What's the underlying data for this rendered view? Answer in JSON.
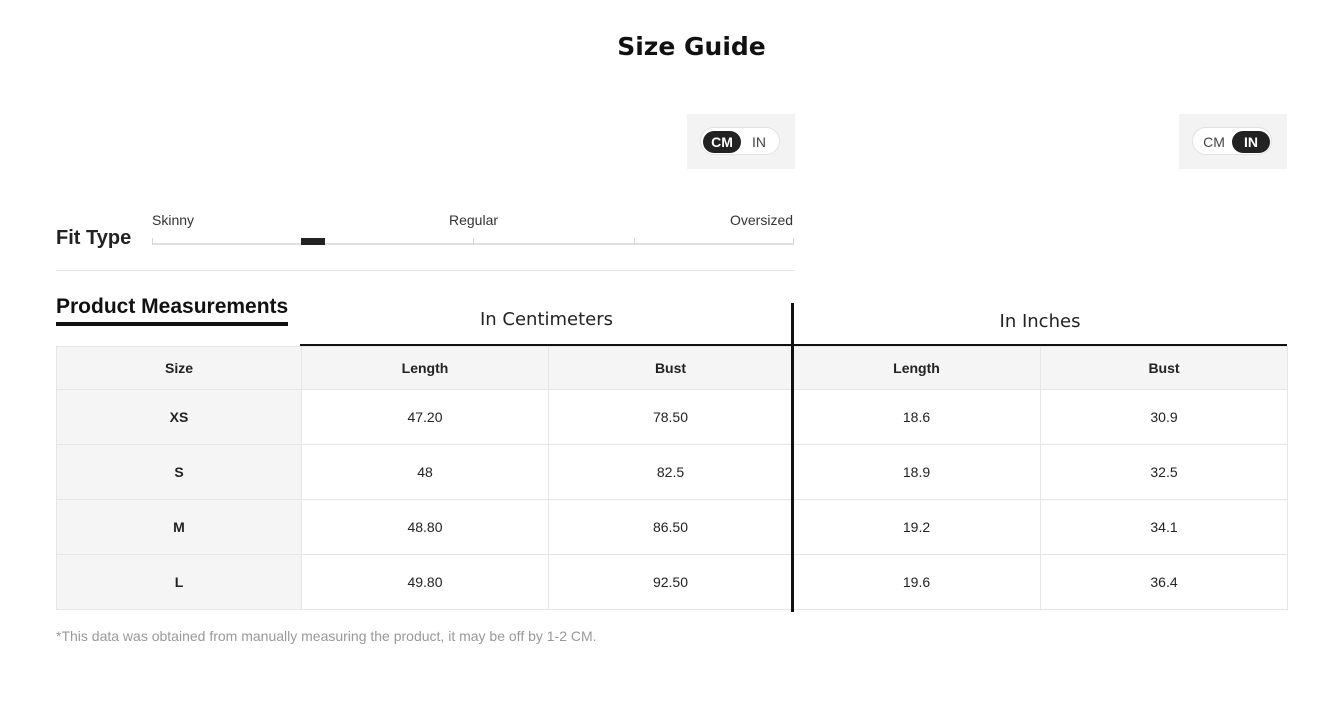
{
  "title": "Size Guide",
  "unit_toggle_cm_section": {
    "options": [
      "CM",
      "IN"
    ],
    "selected": "CM"
  },
  "unit_toggle_in_section": {
    "options": [
      "CM",
      "IN"
    ],
    "selected": "IN"
  },
  "fit_type": {
    "label": "Fit Type",
    "scale_labels": [
      "Skinny",
      "Regular",
      "Oversized"
    ],
    "selected_position": 0.25
  },
  "measurements": {
    "title": "Product Measurements",
    "cm_header": "In Centimeters",
    "in_header": "In Inches",
    "columns": [
      "Size",
      "Length",
      "Bust",
      "Length",
      "Bust"
    ],
    "rows": [
      [
        "XS",
        "47.20",
        "78.50",
        "18.6",
        "30.9"
      ],
      [
        "S",
        "48",
        "82.5",
        "18.9",
        "32.5"
      ],
      [
        "M",
        "48.80",
        "86.50",
        "19.2",
        "34.1"
      ],
      [
        "L",
        "49.80",
        "92.50",
        "19.6",
        "36.4"
      ]
    ]
  },
  "note": "*This data was obtained from manually measuring the product, it may be off by 1-2 CM.",
  "colors": {
    "active_toggle": "#222222",
    "header_bg": "#f5f5f5",
    "note_text": "#999999"
  }
}
